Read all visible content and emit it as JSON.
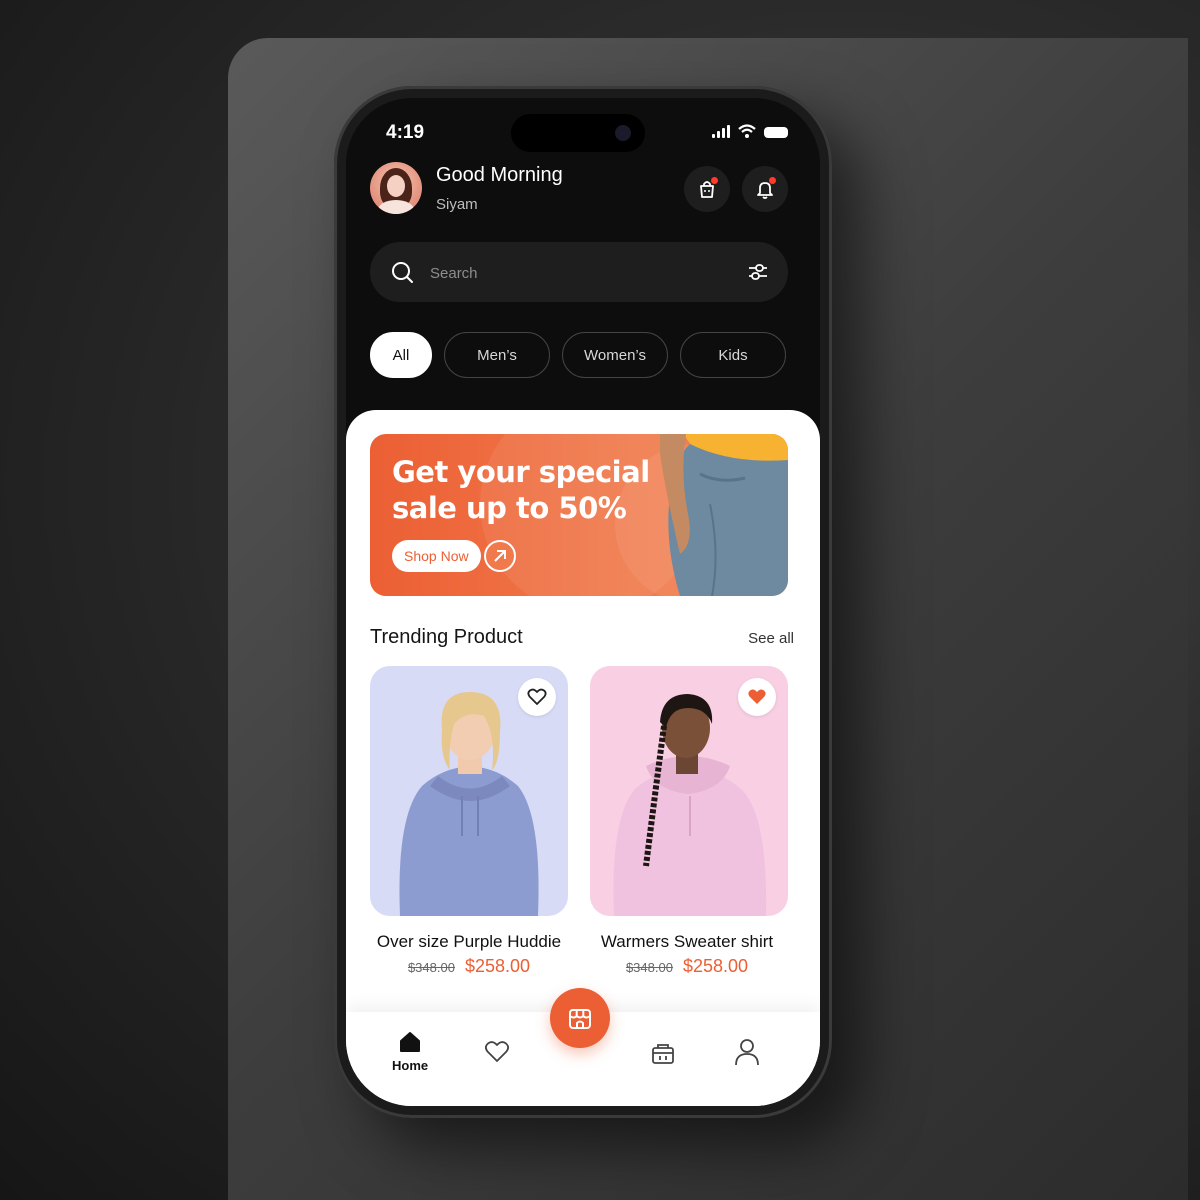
{
  "status_bar": {
    "time": "4:19"
  },
  "header": {
    "greeting": "Good Morning",
    "username": "Siyam"
  },
  "search": {
    "placeholder": "Search"
  },
  "categories": [
    {
      "label": "All",
      "active": true
    },
    {
      "label": "Men’s",
      "active": false
    },
    {
      "label": "Women’s",
      "active": false
    },
    {
      "label": "Kids",
      "active": false
    }
  ],
  "banner": {
    "title_line1": "Get your special",
    "title_line2": "sale up to 50%",
    "button_label": "Shop Now"
  },
  "trending": {
    "title": "Trending Product",
    "see_all": "See all",
    "products": [
      {
        "name": "Over size Purple Huddie",
        "old_price": "$348.00",
        "price": "$258.00",
        "favorited": false
      },
      {
        "name": "Warmers Sweater shirt",
        "old_price": "$348.00",
        "price": "$258.00",
        "favorited": true
      }
    ]
  },
  "nav": {
    "home_label": "Home",
    "items": [
      "home-icon",
      "heart-icon",
      "store-icon",
      "basket-icon",
      "user-icon"
    ]
  },
  "colors": {
    "accent": "#EC5F34",
    "background": "#0D0D0D",
    "sheet": "#FFFFFF"
  }
}
